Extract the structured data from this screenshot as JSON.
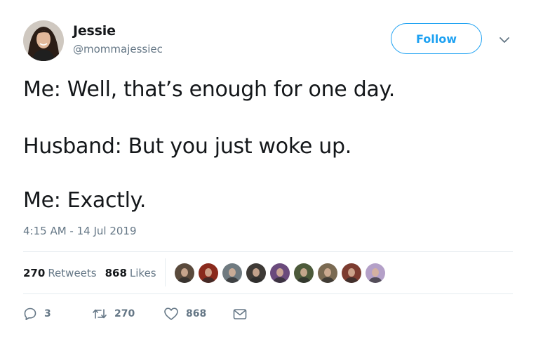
{
  "author": {
    "name": "Jessie",
    "handle": "@mommajessiec",
    "avatar_icon": "profile-photo"
  },
  "follow_button": {
    "label": "Follow"
  },
  "menu": {
    "icon": "chevron-down-icon"
  },
  "tweet": {
    "lines": [
      "Me: Well, that’s enough for one day.",
      "Husband: But you just woke up.",
      "Me: Exactly."
    ],
    "timestamp": "4:15 AM - 14 Jul 2019"
  },
  "stats": {
    "retweets_count": "270",
    "retweets_label": "Retweets",
    "likes_count": "868",
    "likes_label": "Likes"
  },
  "liker_avatars": [
    {
      "color": "#5a4a3c"
    },
    {
      "color": "#8a2a1c"
    },
    {
      "color": "#6f7a80"
    },
    {
      "color": "#3e3a36"
    },
    {
      "color": "#6a4a7c"
    },
    {
      "color": "#4c5a3a"
    },
    {
      "color": "#7a6a52"
    },
    {
      "color": "#7c3c30"
    },
    {
      "color": "#b4a0c8"
    }
  ],
  "actions": {
    "reply_count": "3",
    "retweet_count": "270",
    "like_count": "868"
  },
  "colors": {
    "accent": "#1da1f2",
    "text": "#14171a",
    "secondary": "#657786",
    "divider": "#e6ecf0"
  }
}
